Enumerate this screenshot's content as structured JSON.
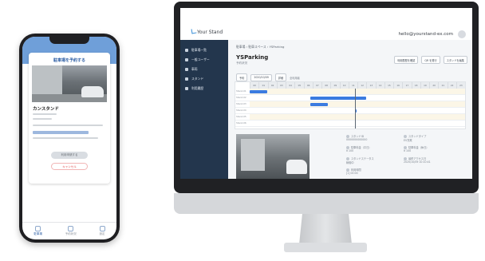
{
  "phone": {
    "card_title": "駐車場を予約する",
    "spot_name": "カンスタンド",
    "btn_primary": "利用申請する",
    "btn_cancel": "キャンセル",
    "tabs": [
      {
        "label": "駐車場",
        "icon": "parking-icon"
      },
      {
        "label": "予約状況",
        "icon": "calendar-icon"
      },
      {
        "label": "設定",
        "icon": "gear-icon"
      }
    ]
  },
  "desktop": {
    "logo": "Your Stand",
    "user_email": "hello@yourstand-ex.com",
    "sidebar": [
      {
        "label": "駐車場一覧",
        "icon": "parking-icon"
      },
      {
        "label": "一般ユーザー",
        "icon": "user-icon"
      },
      {
        "label": "車両",
        "icon": "car-icon"
      },
      {
        "label": "スタンド",
        "icon": "stand-icon"
      },
      {
        "label": "利用履歴",
        "icon": "history-icon"
      }
    ],
    "breadcrumb": "駐車場 › 駐車スペース › YSParking",
    "title": "YSParking",
    "subtitle": "予約状況",
    "actions": [
      "利用履歴を確認",
      "QR を発行",
      "スタンドを編集"
    ],
    "filters": [
      "予約",
      "2020/10/09",
      "詳細"
    ],
    "filter_note": "全利用者",
    "hours": [
      "00",
      "01",
      "02",
      "03",
      "04",
      "05",
      "06",
      "07",
      "08",
      "09",
      "10",
      "11",
      "12",
      "13",
      "14",
      "15",
      "16",
      "17",
      "18",
      "19",
      "20",
      "21",
      "22",
      "23"
    ],
    "rows": [
      "Stand-01",
      "Stand-02",
      "Stand-03",
      "Stand-04",
      "Stand-05",
      "Stand-06"
    ],
    "info": [
      {
        "k": "スタンドID",
        "v": "0000000000000"
      },
      {
        "k": "スタンドタイプ",
        "v": "EV充電"
      },
      {
        "k": "駐車料金（平日）",
        "v": "¥ 100"
      },
      {
        "k": "駐車料金（休日）",
        "v": "¥ 100"
      },
      {
        "k": "スタンドステータス",
        "v": "稼働中"
      },
      {
        "k": "最終アクセス日",
        "v": "2020/10/09 10:10:41"
      },
      {
        "k": "利用時間",
        "v": "[1] 00:00"
      }
    ]
  }
}
